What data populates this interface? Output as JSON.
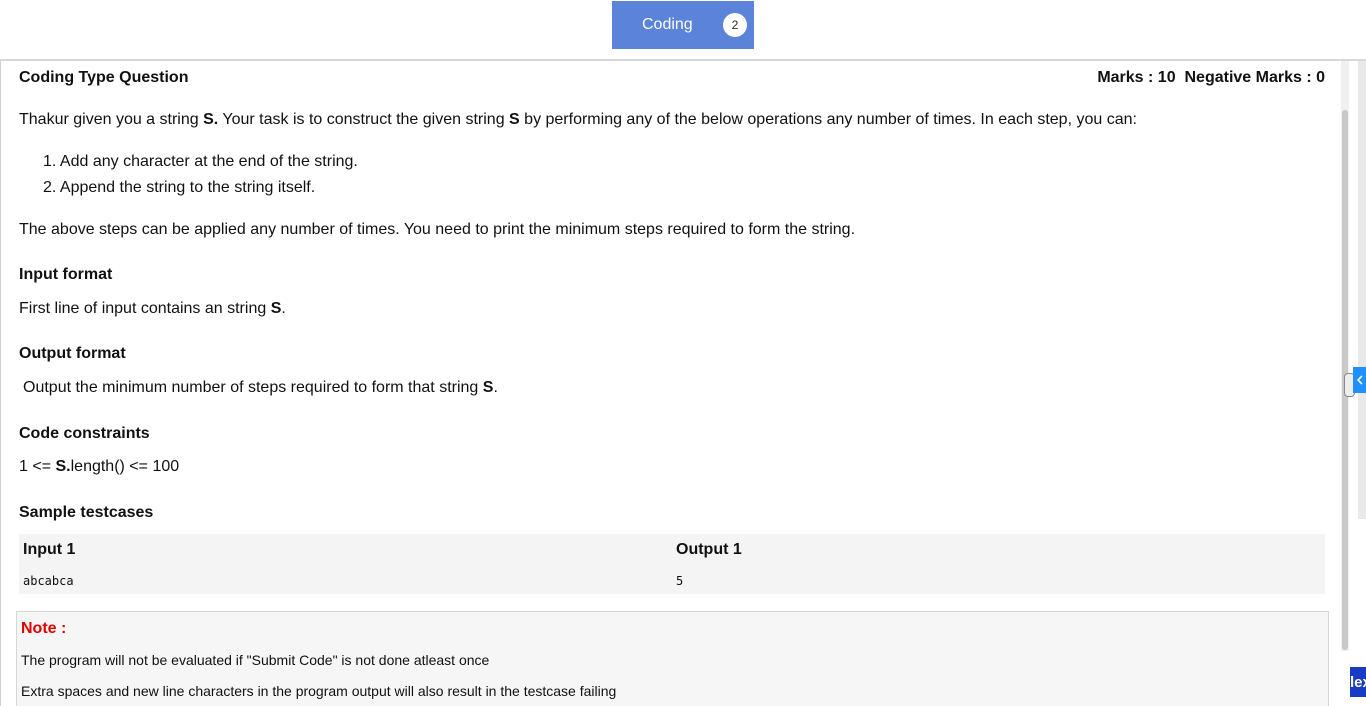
{
  "tabs": [
    {
      "label": "Coding",
      "badge": "2"
    }
  ],
  "question": {
    "type_label": "Coding Type Question",
    "marks_label": "Marks : 10",
    "negative_marks_label": "Negative Marks : 0",
    "statement": {
      "pre": "Thakur given you a string ",
      "s1": "S.",
      "mid": " Your task is to construct the given string ",
      "s2": "S",
      "post": " by performing any of the below operations any number of times. In each step, you can:"
    },
    "operations": [
      "1. Add any character at the end of the string.",
      "2. Append the string to the string itself."
    ],
    "summary": "The above steps can be applied any number of times. You need to print the minimum steps required to form the string.",
    "input_format": {
      "heading": "Input format",
      "pre": "First line of input contains an string ",
      "var": "S",
      "post": "."
    },
    "output_format": {
      "heading": "Output format",
      "pre": "Output the minimum number of steps required to form that string ",
      "var": "S",
      "post": "."
    },
    "constraints": {
      "heading": "Code constraints",
      "pre": "1 <= ",
      "var": "S.",
      "post": "length() <= 100"
    },
    "samples": {
      "heading": "Sample testcases",
      "input_header": "Input 1",
      "output_header": "Output 1",
      "input_value": "abcabca",
      "output_value": "5"
    }
  },
  "note": {
    "title": "Note :",
    "lines": [
      "The program will not be evaluated if \"Submit Code\" is not done atleast once",
      "Extra spaces and new line characters in the program output will also result in the testcase failing"
    ]
  },
  "next_button": {
    "label": "lex"
  },
  "colors": {
    "tab_bg": "#5b83d9",
    "note_title": "#e00000",
    "next_bg": "#1a3cc4",
    "collapse_bg": "#1e90ff"
  },
  "icons": {
    "collapse": "chevron-left-icon",
    "resize": "drag-handle-icon"
  }
}
